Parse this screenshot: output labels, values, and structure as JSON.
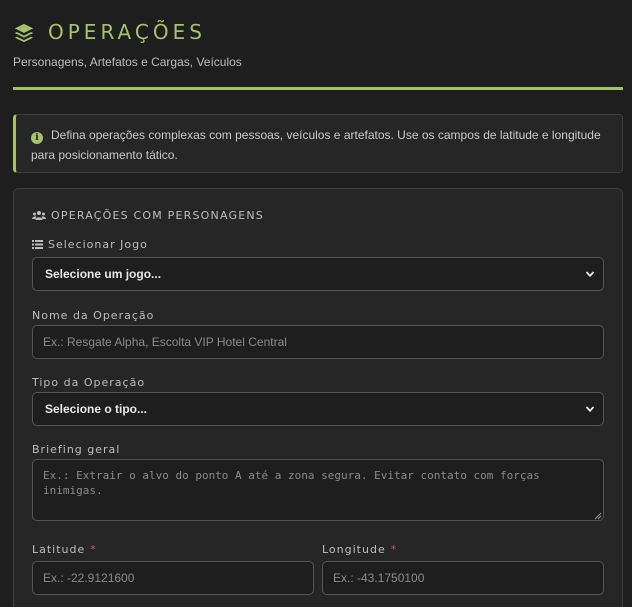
{
  "header": {
    "title": "OPERAÇÕES",
    "subtitle": "Personagens, Artefatos e Cargas, Veículos"
  },
  "info": {
    "text": "Defina operações complexas com pessoas, veículos e artefatos. Use os campos de latitude e longitude para posicionamento tático."
  },
  "section": {
    "title": "OPERAÇÕES COM PERSONAGENS"
  },
  "form": {
    "game": {
      "label": "Selecionar Jogo",
      "selected": "Selecione um jogo..."
    },
    "name": {
      "label": "Nome da Operação",
      "placeholder": "Ex.: Resgate Alpha, Escolta VIP Hotel Central"
    },
    "type": {
      "label": "Tipo da Operação",
      "selected": "Selecione o tipo..."
    },
    "briefing": {
      "label": "Briefing geral",
      "placeholder": "Ex.: Extrair o alvo do ponto A até a zona segura. Evitar contato com forças inimigas."
    },
    "latitude": {
      "label": "Latitude",
      "required_mark": "*",
      "placeholder": "Ex.: -22.9121600"
    },
    "longitude": {
      "label": "Longitude",
      "required_mark": "*",
      "placeholder": "Ex.: -43.1750100"
    }
  },
  "colors": {
    "accent": "#a5c26b",
    "background": "#1e1e1e",
    "card": "#262626",
    "required": "#e05252"
  },
  "icons": {
    "title": "layers-icon",
    "info": "info-icon",
    "section": "users-icon",
    "game_label": "list-icon",
    "select_arrow": "chevron-down-icon"
  }
}
